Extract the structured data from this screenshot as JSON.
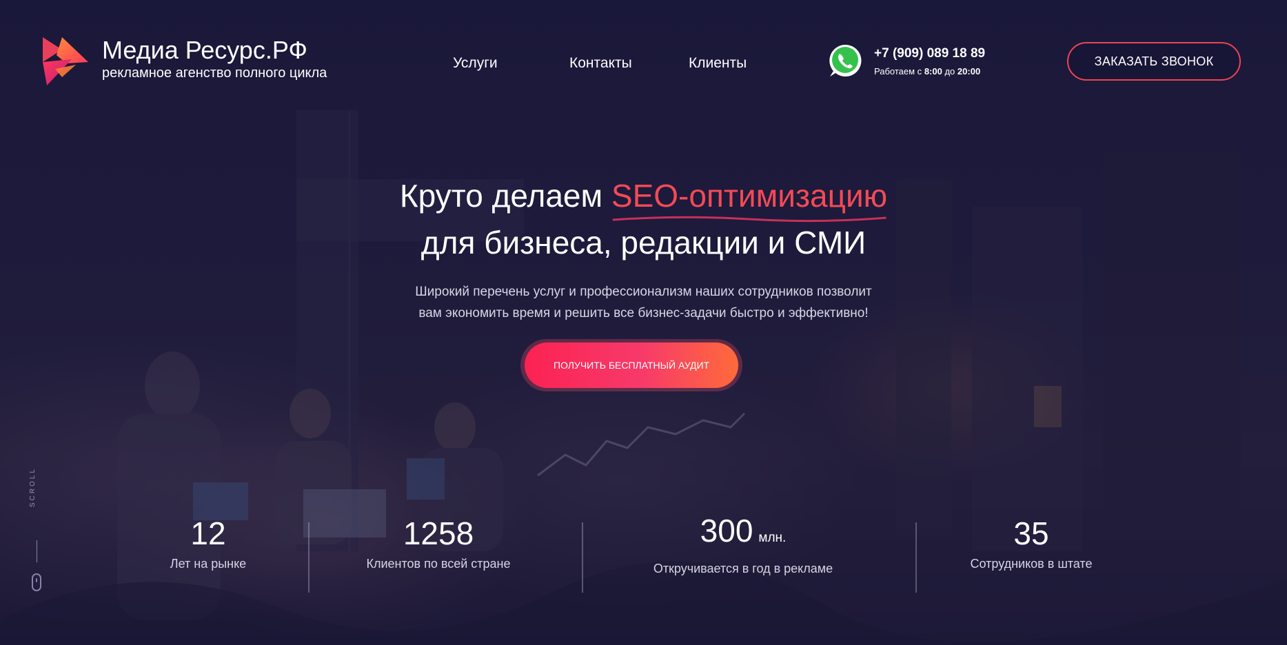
{
  "brand": {
    "name": "Медиа Ресурс.РФ",
    "tagline": "рекламное агенство полного цикла"
  },
  "nav": {
    "items": [
      "Услуги",
      "Контакты",
      "Клиенты"
    ]
  },
  "contact": {
    "phone": "+7 (909) 089 18 89",
    "hours_prefix": "Работаем с",
    "hours_from": "8:00",
    "hours_mid": "до",
    "hours_to": "20:00",
    "icon": "whatsapp-icon"
  },
  "callback_button": "ЗАКАЗАТЬ ЗВОНОК",
  "hero": {
    "title_part1": "Круто делаем",
    "title_accent": "SEO-оптимизацию",
    "title_line2": "для бизнеса, редакции и СМИ",
    "subtitle_line1": "Широкий перечень услуг и профессионализм наших сотрудников позволит",
    "subtitle_line2": "вам экономить время и решить все бизнес-задачи быстро и эффективно!",
    "cta": "ПОЛУЧИТЬ БЕСПЛАТНЫЙ АУДИТ"
  },
  "stats": [
    {
      "value": "12",
      "unit": "",
      "label": "Лет на рынке"
    },
    {
      "value": "1258",
      "unit": "",
      "label": "Клиентов по всей стране"
    },
    {
      "value": "300",
      "unit": "млн.",
      "label": "Откручивается в год в рекламе"
    },
    {
      "value": "35",
      "unit": "",
      "label": "Сотрудников в штате"
    }
  ],
  "scroll_label": "SCROLL",
  "colors": {
    "accent": "#f34a55",
    "background": "#1c1a3a",
    "cta_start": "#fb2253",
    "cta_end": "#ff6a3a"
  }
}
